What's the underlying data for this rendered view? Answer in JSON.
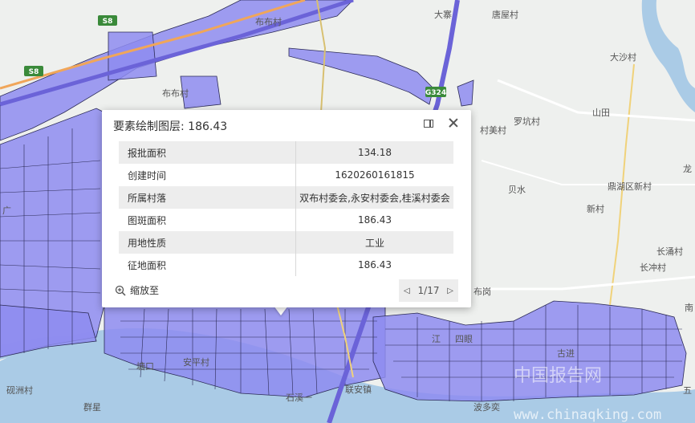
{
  "map": {
    "labels": [
      "大寨",
      "唐屋村",
      "大沙村",
      "山田",
      "布布村",
      "布布村",
      "罗坑村",
      "村美村",
      "贝水",
      "鼎湖区新村",
      "新村",
      "长涌村",
      "长冲村",
      "龙",
      "南",
      "布岗",
      "江",
      "四眼",
      "石溪一",
      "联安镇",
      "塘口",
      "砚洲村",
      "群星",
      "波多奕",
      "广",
      "古进",
      "五",
      "安平村"
    ],
    "shields": [
      "S8",
      "S8",
      "G324"
    ],
    "watermark": "中国报告网",
    "watermark_url": "www.chinaqking.com"
  },
  "popup": {
    "title": "要素绘制图层: 186.43",
    "rows": [
      {
        "key": "报批面积",
        "value": "134.18"
      },
      {
        "key": "创建时间",
        "value": "1620260161815"
      },
      {
        "key": "所属村落",
        "value": "双布村委会,永安村委会,桂溪村委会"
      },
      {
        "key": "图斑面积",
        "value": "186.43"
      },
      {
        "key": "用地性质",
        "value": "工业"
      },
      {
        "key": "征地面积",
        "value": "186.43"
      }
    ],
    "zoom_label": "缩放至",
    "pager": "1/17"
  }
}
